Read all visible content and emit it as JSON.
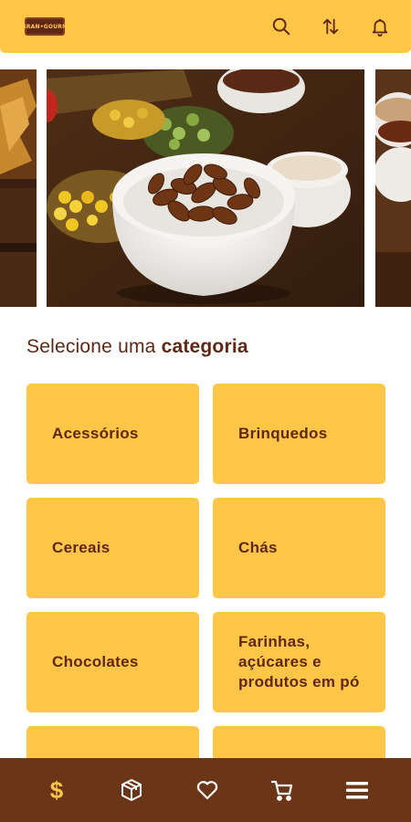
{
  "header": {
    "logo_text": "GRAN•GOURM",
    "icons": [
      "search-icon",
      "sort-icon",
      "bell-icon"
    ]
  },
  "banner": {
    "slides": 3
  },
  "section": {
    "title_regular": "Selecione uma ",
    "title_bold": "categoria"
  },
  "categories": [
    {
      "label": "Acessórios"
    },
    {
      "label": "Brinquedos"
    },
    {
      "label": "Cereais"
    },
    {
      "label": "Chás"
    },
    {
      "label": "Chocolates"
    },
    {
      "label": "Farinhas, açúcares e produtos em pó"
    },
    {
      "label": ""
    },
    {
      "label": ""
    }
  ],
  "bottom_nav": {
    "items": [
      {
        "icon": "dollar-icon",
        "glyph": "$"
      },
      {
        "icon": "box-icon"
      },
      {
        "icon": "heart-icon"
      },
      {
        "icon": "cart-icon"
      },
      {
        "icon": "menu-icon"
      }
    ]
  },
  "colors": {
    "accent": "#ffc648",
    "brand_brown": "#5f2816",
    "nav_brown": "#6b3518"
  }
}
